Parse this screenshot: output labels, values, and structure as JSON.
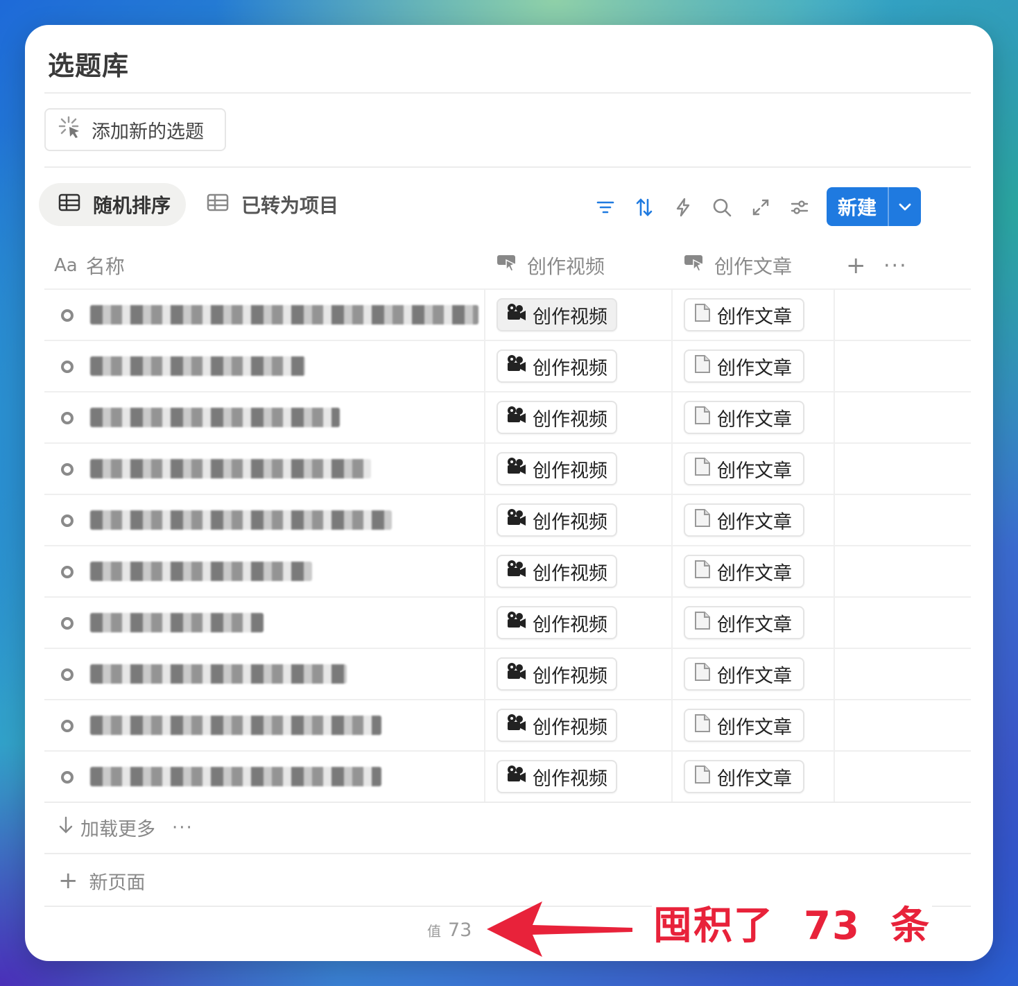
{
  "page": {
    "title": "选题库",
    "add_button_label": "添加新的选题",
    "view_tabs": [
      {
        "label": "随机排序",
        "active": true
      },
      {
        "label": "已转为项目",
        "active": false
      }
    ],
    "toolbar_icons": [
      "filter-icon",
      "sort-icon",
      "lightning-icon",
      "search-icon",
      "expand-icon",
      "settings-icon"
    ],
    "new_button_label": "新建",
    "accent_color": "#1f7ae0"
  },
  "table": {
    "columns": [
      {
        "icon": "Aa",
        "label": "名称"
      },
      {
        "icon": "button-cursor-icon",
        "label": "创作视频"
      },
      {
        "icon": "button-cursor-icon",
        "label": "创作文章"
      }
    ],
    "rows": [
      {
        "video_label": "创作视频",
        "article_label": "创作文章"
      },
      {
        "video_label": "创作视频",
        "article_label": "创作文章"
      },
      {
        "video_label": "创作视频",
        "article_label": "创作文章"
      },
      {
        "video_label": "创作视频",
        "article_label": "创作文章"
      },
      {
        "video_label": "创作视频",
        "article_label": "创作文章"
      },
      {
        "video_label": "创作视频",
        "article_label": "创作文章"
      },
      {
        "video_label": "创作视频",
        "article_label": "创作文章"
      },
      {
        "video_label": "创作视频",
        "article_label": "创作文章"
      },
      {
        "video_label": "创作视频",
        "article_label": "创作文章"
      },
      {
        "video_label": "创作视频",
        "article_label": "创作文章"
      }
    ],
    "load_more_label": "加载更多",
    "new_page_label": "新页面",
    "count_key": "值",
    "count_value": "73"
  },
  "annotation": {
    "text": "囤积了  73  条",
    "color": "#e8223a"
  }
}
